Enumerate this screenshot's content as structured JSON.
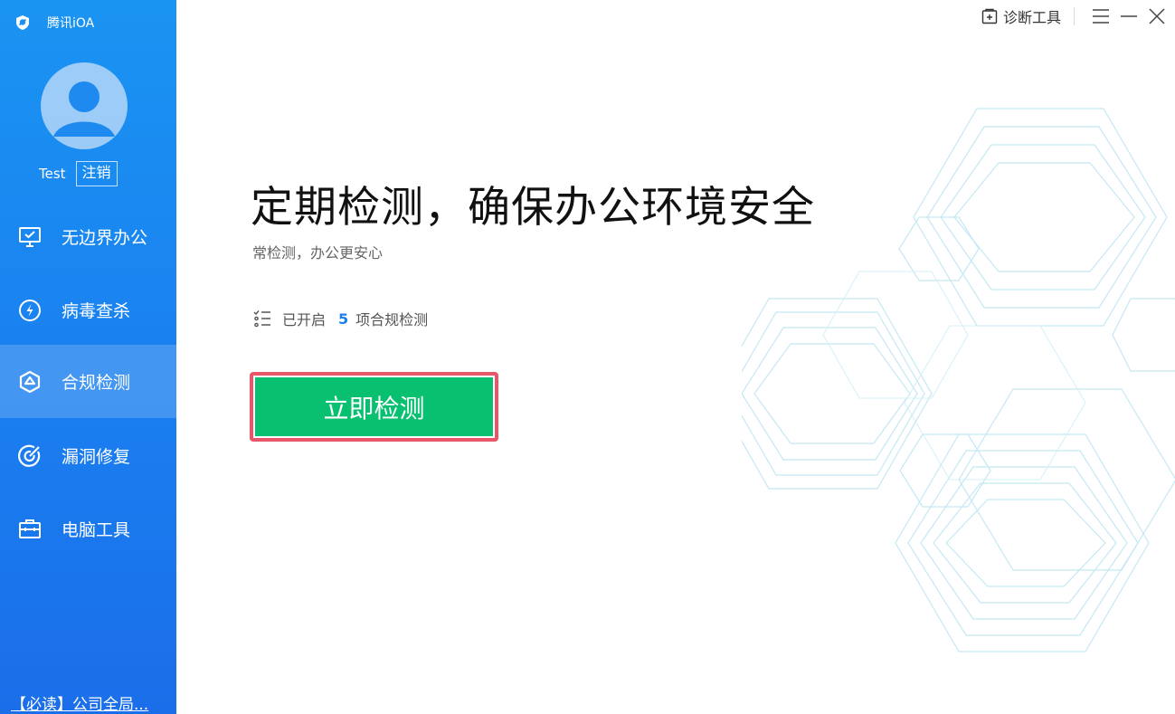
{
  "brand": {
    "name": "腾讯iOA"
  },
  "user": {
    "name": "Test",
    "logout_label": "注销"
  },
  "sidebar": {
    "items": [
      {
        "label": "无边界办公",
        "icon": "monitor-icon",
        "active": false
      },
      {
        "label": "病毒查杀",
        "icon": "lightning-icon",
        "active": false
      },
      {
        "label": "合规检测",
        "icon": "compliance-cube-icon",
        "active": true
      },
      {
        "label": "漏洞修复",
        "icon": "target-icon",
        "active": false
      },
      {
        "label": "电脑工具",
        "icon": "toolbox-icon",
        "active": false
      }
    ],
    "notice": "【必读】公司全局..."
  },
  "titlebar": {
    "diagnose_label": "诊断工具"
  },
  "main": {
    "title": "定期检测，确保办公环境安全",
    "subtitle": "常检测，办公更安心",
    "status_prefix": "已开启",
    "status_count": "5",
    "status_suffix": "项合规检测",
    "scan_button": "立即检测"
  },
  "colors": {
    "sidebar_top": "#1a94f2",
    "sidebar_bottom": "#1b6ee9",
    "primary_button": "#08c070",
    "highlight_outline": "#e8566a",
    "count_accent": "#1a7ff0"
  }
}
